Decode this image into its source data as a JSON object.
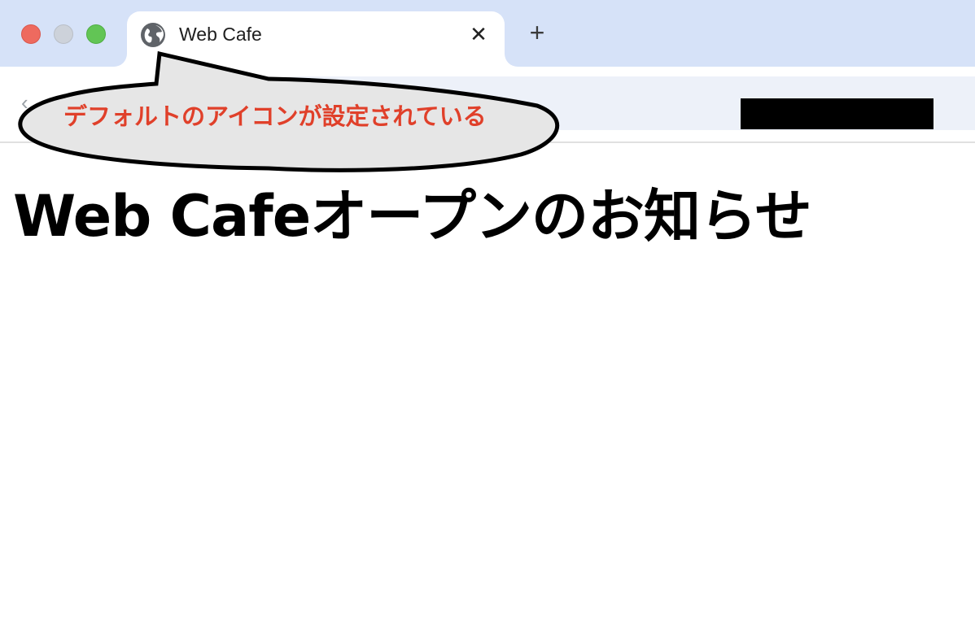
{
  "window": {
    "controls": {
      "close_color": "#ee6a5f",
      "minimize_color": "#cdd2da",
      "maximize_color": "#62c555"
    }
  },
  "tab": {
    "icon": "globe-icon",
    "title": "Web Cafe",
    "close_glyph": "✕"
  },
  "new_tab": {
    "glyph": "+"
  },
  "toolbar": {
    "back_glyph": "‹"
  },
  "annotation": {
    "text": "デフォルトのアイコンが設定されている",
    "text_color": "#e0402a"
  },
  "page": {
    "heading": "Web Cafeオープンのお知らせ"
  },
  "colors": {
    "tabbar_bg": "#d6e2f8",
    "omnibox_bg": "#edf1f9"
  }
}
